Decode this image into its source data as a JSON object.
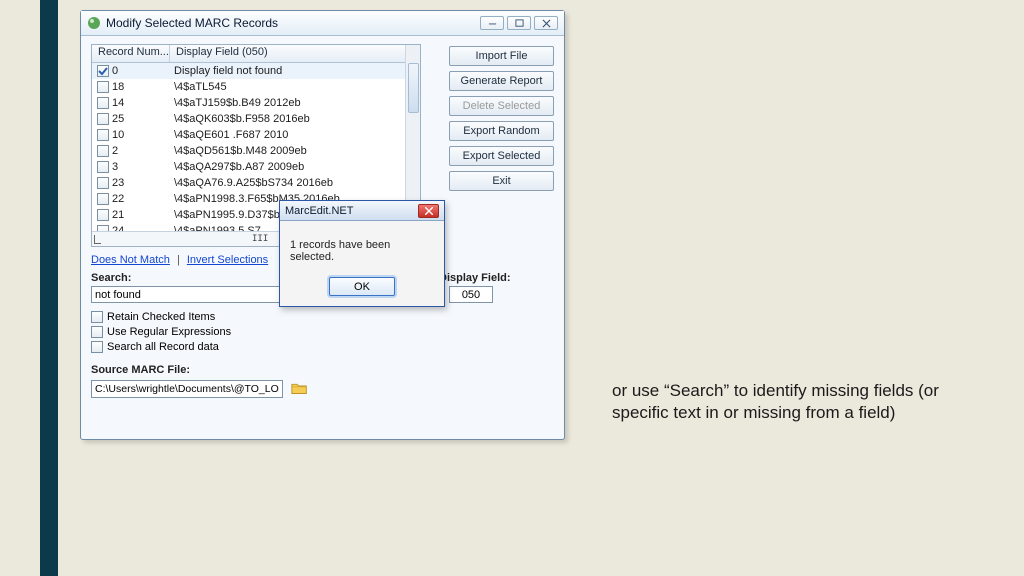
{
  "annotation": "or use “Search” to identify missing fields (or specific text in or missing from a field)",
  "window": {
    "title": "Modify Selected MARC Records",
    "columns": {
      "col1": "Record Num...",
      "col2": "Display Field (050)"
    },
    "rows": [
      {
        "checked": true,
        "num": "0",
        "field": "Display field not found"
      },
      {
        "checked": false,
        "num": "18",
        "field": "\\4$aTL545"
      },
      {
        "checked": false,
        "num": "14",
        "field": "\\4$aTJ159$b.B49 2012eb"
      },
      {
        "checked": false,
        "num": "25",
        "field": "\\4$aQK603$b.F958 2016eb"
      },
      {
        "checked": false,
        "num": "10",
        "field": "\\4$aQE601 .F687 2010"
      },
      {
        "checked": false,
        "num": "2",
        "field": "\\4$aQD561$b.M48 2009eb"
      },
      {
        "checked": false,
        "num": "3",
        "field": "\\4$aQA297$b.A87 2009eb"
      },
      {
        "checked": false,
        "num": "23",
        "field": "\\4$aQA76.9.A25$bS734 2016eb"
      },
      {
        "checked": false,
        "num": "22",
        "field": "\\4$aPN1998.3.F65$bM35 2016eb"
      },
      {
        "checked": false,
        "num": "21",
        "field": "\\4$aPN1995.9.D37$b"
      },
      {
        "checked": false,
        "num": "24",
        "field": "\\4$aPN1993.5.S7"
      }
    ],
    "links": {
      "does_not_match": "Does Not Match",
      "invert": "Invert Selections"
    },
    "buttons": {
      "import": "Import File",
      "generate": "Generate Report",
      "delete": "Delete Selected",
      "export_random": "Export Random",
      "export_selected": "Export Selected",
      "exit": "Exit"
    },
    "search": {
      "label": "Search:",
      "value": "not found"
    },
    "display": {
      "label": "Display Field:",
      "value": "050"
    },
    "opts": {
      "retain": "Retain Checked Items",
      "regex": "Use Regular Expressions",
      "searchall": "Search all Record data"
    },
    "source": {
      "label": "Source MARC File:",
      "value": "C:\\Users\\wrightle\\Documents\\@TO_LOAD"
    },
    "footer_caret": "III"
  },
  "dialog": {
    "title": "MarcEdit.NET",
    "message": "1 records have been selected.",
    "ok": "OK"
  }
}
